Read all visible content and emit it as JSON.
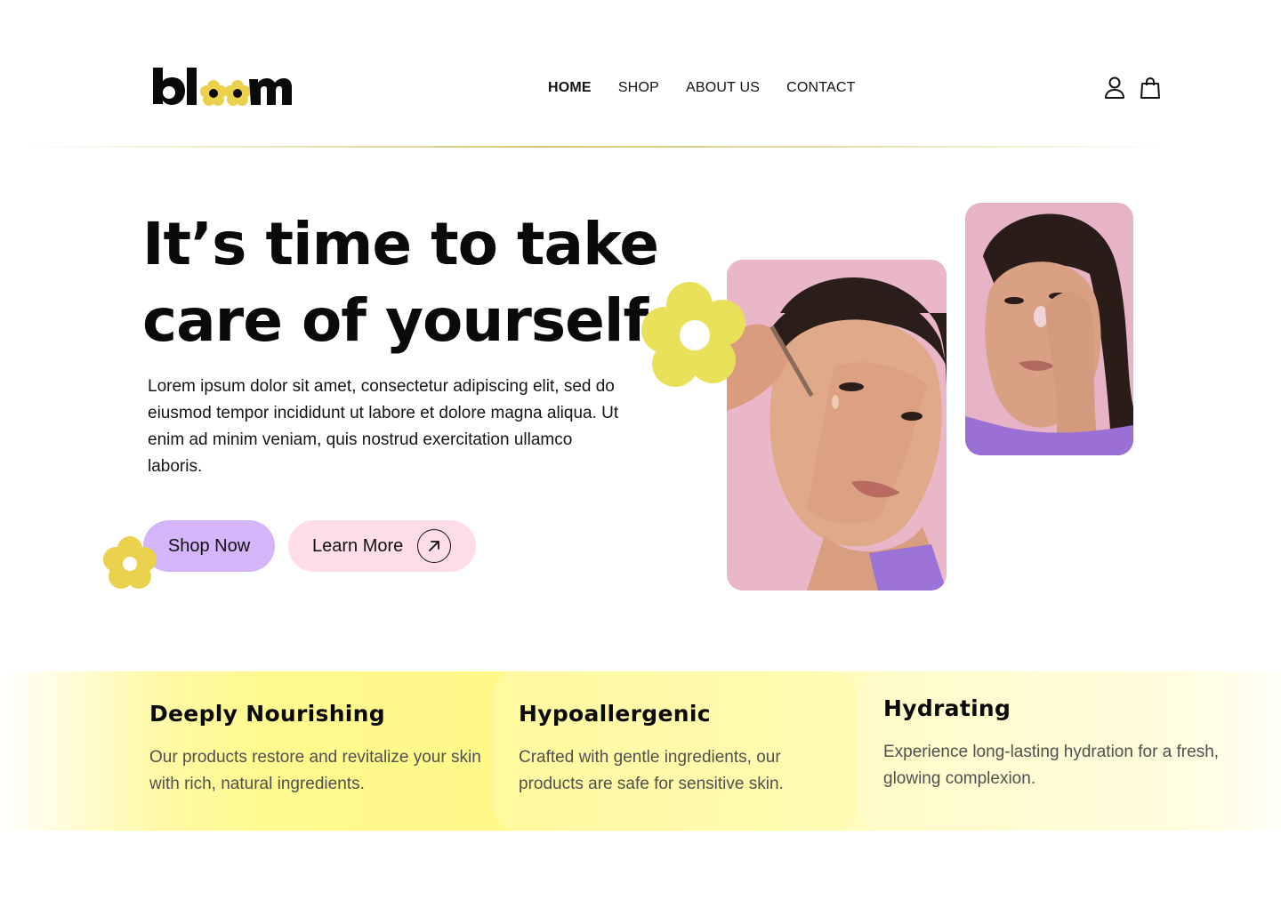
{
  "brand": {
    "name": "bloom",
    "accent": "#ead24f",
    "lavender": "#d4b5fa",
    "pink": "#ffdde7"
  },
  "nav": {
    "items": [
      {
        "label": "HOME",
        "active": true
      },
      {
        "label": "SHOP",
        "active": false
      },
      {
        "label": "ABOUT US",
        "active": false
      },
      {
        "label": "CONTACT",
        "active": false
      }
    ]
  },
  "header_icons": [
    "user-icon",
    "shopping-bag-icon"
  ],
  "hero": {
    "title_line1": "It’s time to take",
    "title_line2": "care of yourself",
    "description": "Lorem ipsum dolor sit amet, consectetur adipiscing elit, sed do eiusmod tempor incididunt ut labore et dolore magna aliqua. Ut enim ad minim veniam, quis nostrud exercitation ullamco laboris.",
    "primary_cta": "Shop Now",
    "secondary_cta": "Learn More",
    "secondary_icon": "arrow-up-right-icon"
  },
  "features": [
    {
      "title": "Deeply Nourishing",
      "description": "Our products restore and revitalize your skin with rich, natural ingredients."
    },
    {
      "title": "Hypoallergenic",
      "description": "Crafted with gentle ingredients, our products are safe for sensitive skin."
    },
    {
      "title": "Hydrating",
      "description": "Experience long-lasting hydration for a fresh, glowing complexion."
    }
  ]
}
